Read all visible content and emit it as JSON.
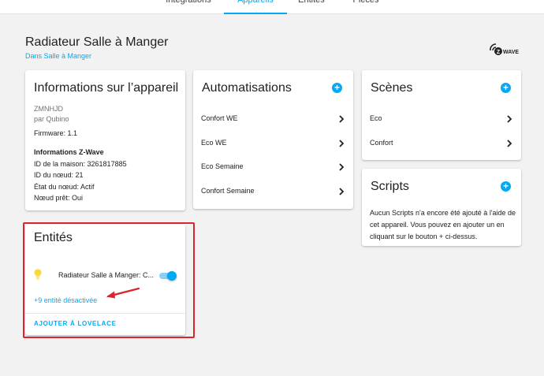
{
  "nav": {
    "tabs": [
      {
        "label": "Intégrations"
      },
      {
        "label": "Appareils"
      },
      {
        "label": "Entités"
      },
      {
        "label": "Pièces"
      }
    ],
    "active_tab": "Appareils"
  },
  "device": {
    "name": "Radiateur Salle à Manger",
    "area_link": "Dans Salle à Manger",
    "logo_text": "WAVE",
    "logo_letter": "Z"
  },
  "info_card": {
    "title": "Informations sur l’appareil",
    "model": "ZMNHJD",
    "manufacturer": "par Qubino",
    "firmware": "Firmware: 1.1",
    "zwave_heading": "Informations Z-Wave",
    "home_id": "ID de la maison: 3261817885",
    "node_id": "ID du nœud: 21",
    "node_state": "État du nœud: Actif",
    "node_ready": "Nœud prêt: Oui"
  },
  "automations_card": {
    "title": "Automatisations",
    "items": [
      {
        "label": "Confort WE"
      },
      {
        "label": "Eco WE"
      },
      {
        "label": "Eco Semaine"
      },
      {
        "label": "Confort Semaine"
      }
    ]
  },
  "scenes_card": {
    "title": "Scènes",
    "items": [
      {
        "label": "Eco"
      },
      {
        "label": "Confort"
      }
    ]
  },
  "scripts_card": {
    "title": "Scripts",
    "empty_text": "Aucun Scripts n'a encore été ajouté à l'aide de cet appareil. Vous pouvez en ajouter un en cliquant sur le bouton + ci-dessus."
  },
  "entities_card": {
    "title": "Entités",
    "entity_name": "Radiateur Salle à Manger: C...",
    "entity_on": true,
    "disabled_link": "+9 entité désactivée",
    "lovelace_button": "AJOUTER À LOVELACE"
  },
  "colors": {
    "accent": "#03a9f4",
    "annotation": "#d8252e",
    "bulb": "#fdd835"
  },
  "icons": {
    "add": "plus-circle-icon",
    "chevron": "chevron-right-icon",
    "entity": "lightbulb-icon"
  }
}
